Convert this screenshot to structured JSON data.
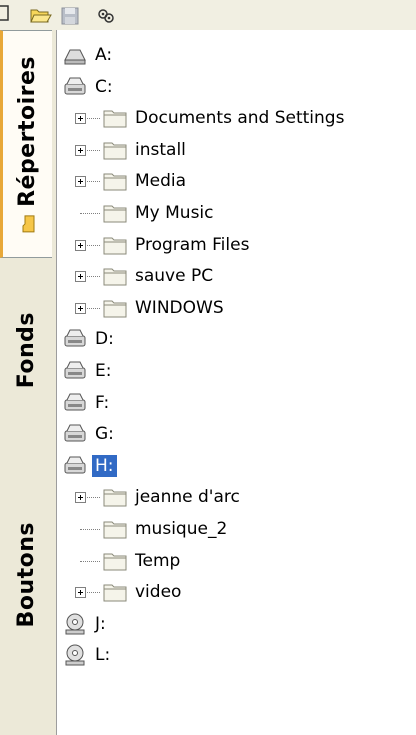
{
  "toolbar": {
    "buttons": [
      {
        "name": "open-folder-icon"
      },
      {
        "name": "save-icon"
      },
      {
        "name": "settings-icon"
      }
    ]
  },
  "tabs": [
    {
      "label": "Répertoires",
      "active": true
    },
    {
      "label": "Fonds",
      "active": false
    },
    {
      "label": "Boutons",
      "active": false
    }
  ],
  "tree": [
    {
      "label": "A:",
      "type": "drive-floppy"
    },
    {
      "label": "C:",
      "type": "drive"
    },
    {
      "label": "Documents and Settings",
      "type": "folder",
      "expandable": true
    },
    {
      "label": "install",
      "type": "folder",
      "expandable": true
    },
    {
      "label": "Media",
      "type": "folder",
      "expandable": true
    },
    {
      "label": "My Music",
      "type": "folder",
      "expandable": false
    },
    {
      "label": "Program Files",
      "type": "folder",
      "expandable": true
    },
    {
      "label": "sauve PC",
      "type": "folder",
      "expandable": true
    },
    {
      "label": "WINDOWS",
      "type": "folder",
      "expandable": true
    },
    {
      "label": "D:",
      "type": "drive"
    },
    {
      "label": "E:",
      "type": "drive"
    },
    {
      "label": "F:",
      "type": "drive"
    },
    {
      "label": "G:",
      "type": "drive"
    },
    {
      "label": "H:",
      "type": "drive",
      "selected": true
    },
    {
      "label": "jeanne d'arc",
      "type": "folder",
      "expandable": true
    },
    {
      "label": "musique_2",
      "type": "folder",
      "expandable": false
    },
    {
      "label": "Temp",
      "type": "folder",
      "expandable": false
    },
    {
      "label": "video",
      "type": "folder",
      "expandable": true
    },
    {
      "label": "J:",
      "type": "drive-cd"
    },
    {
      "label": "L:",
      "type": "drive-cd"
    }
  ],
  "colors": {
    "selection": "#316ac5",
    "active_tab_accent": "#e8a838",
    "folder": "#f5f4ea"
  }
}
